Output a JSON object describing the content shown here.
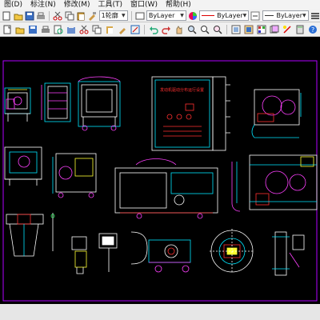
{
  "menu": {
    "items": [
      "图(D)",
      "标注(N)",
      "修改(M)",
      "工具(T)",
      "窗口(W)",
      "帮助(H)"
    ]
  },
  "toolbar": {
    "dimstyle_value": "1轮廓",
    "layer_color": "ByLayer",
    "linetype": "ByLayer",
    "lineweight": "ByLayer"
  },
  "drawing": {
    "panel_title": "发动机驱动分布运行设置"
  },
  "colors": {
    "canvas_bg": "#000000",
    "line_cyan": "#00e5ff",
    "line_white": "#ffffff",
    "line_magenta": "#ff40ff",
    "line_red": "#ff3030",
    "line_yellow": "#ffff33",
    "line_green": "#33ff66",
    "frame_purple": "#b000ff"
  }
}
